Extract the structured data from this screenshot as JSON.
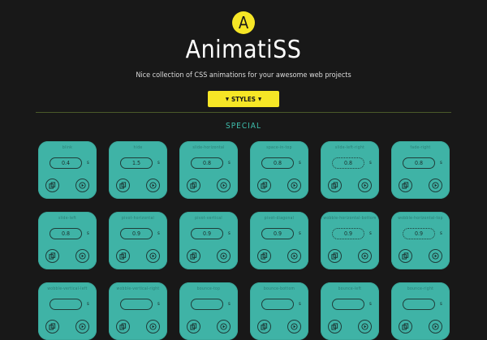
{
  "logo": {
    "letter": "A"
  },
  "brand": {
    "title": "AnimatiSS"
  },
  "tagline": "Nice collection of CSS animations for your awesome web projects",
  "styles_button": {
    "label": "STYLES"
  },
  "section": {
    "title": "SPECIAL"
  },
  "colors": {
    "accent": "#f6e626",
    "card": "#3fb3a6",
    "background": "#181818",
    "section": "#3fbfae"
  },
  "cards": [
    {
      "name": "blink",
      "value": "0.4",
      "unit": "s"
    },
    {
      "name": "hide",
      "value": "1.5",
      "unit": "s"
    },
    {
      "name": "slide-horizontal",
      "value": "0.8",
      "unit": "s"
    },
    {
      "name": "space-in-top",
      "value": "0.8",
      "unit": "s"
    },
    {
      "name": "slide-left-right",
      "value": "0.8",
      "unit": "s"
    },
    {
      "name": "fade-right",
      "value": "0.8",
      "unit": "s"
    },
    {
      "name": "slide-left",
      "value": "0.8",
      "unit": "s"
    },
    {
      "name": "pivot-horizontal",
      "value": "0.9",
      "unit": "s"
    },
    {
      "name": "pivot-vertical",
      "value": "0.9",
      "unit": "s"
    },
    {
      "name": "pivot-diagonal",
      "value": "0.9",
      "unit": "s"
    },
    {
      "name": "wobble-horizontal-bottom",
      "value": "0.9",
      "unit": "s"
    },
    {
      "name": "wobble-horizontal-top",
      "value": "0.9",
      "unit": "s"
    },
    {
      "name": "wobble-vertical-left",
      "value": "",
      "unit": "s"
    },
    {
      "name": "wobble-vertical-right",
      "value": "",
      "unit": "s"
    },
    {
      "name": "bounce-top",
      "value": "",
      "unit": "s"
    },
    {
      "name": "bounce-bottom",
      "value": "",
      "unit": "s"
    },
    {
      "name": "bounce-left",
      "value": "",
      "unit": "s"
    },
    {
      "name": "bounce-right",
      "value": "",
      "unit": "s"
    }
  ]
}
